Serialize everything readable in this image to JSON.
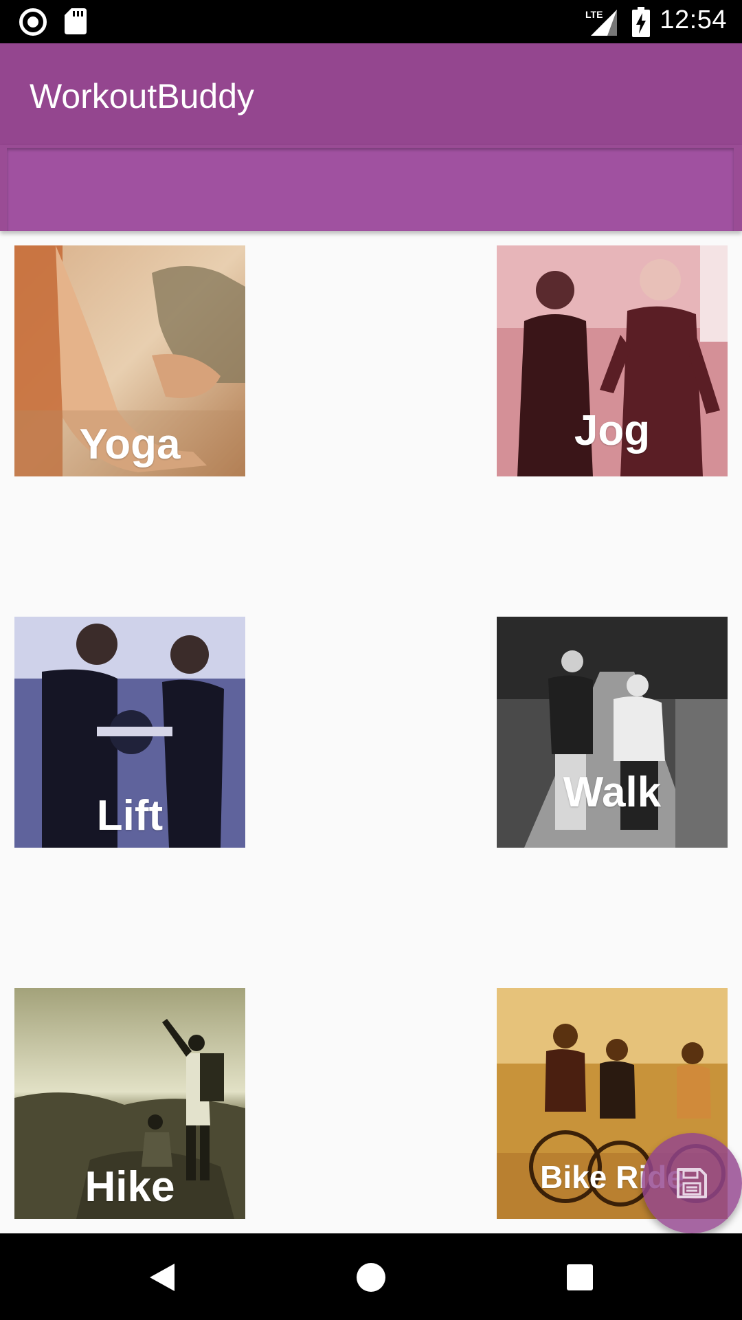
{
  "status_bar": {
    "time": "12:54",
    "network": "LTE",
    "icons": [
      "record-icon",
      "sd-card-icon",
      "lte-signal-icon",
      "battery-charging-icon"
    ]
  },
  "app_bar": {
    "title": "WorkoutBuddy"
  },
  "workouts": [
    {
      "label": "Yoga",
      "tint": "#c9895a"
    },
    {
      "label": "Jog",
      "tint": "#a65a63"
    },
    {
      "label": "Lift",
      "tint": "#4b4e8a"
    },
    {
      "label": "Walk",
      "tint": "#6e6e6e"
    },
    {
      "label": "Hike",
      "tint": "#7a7a52"
    },
    {
      "label": "Bike Ride",
      "tint": "#b88427"
    }
  ],
  "fab": {
    "icon": "save-icon",
    "color": "#94468f"
  },
  "nav_bar": {
    "icons": [
      "back-icon",
      "home-icon",
      "recents-icon"
    ]
  },
  "colors": {
    "primary": "#94468f",
    "background": "#fafafa"
  }
}
